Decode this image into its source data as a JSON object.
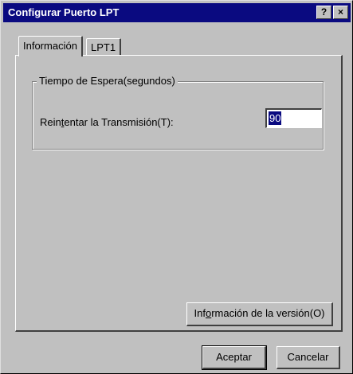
{
  "window": {
    "title": "Configurar Puerto LPT",
    "help_label": "?",
    "close_label": "×"
  },
  "tabs": [
    {
      "label": "Información",
      "active": true
    },
    {
      "label": "LPT1",
      "active": false
    }
  ],
  "group": {
    "legend": "Tiempo de Espera(segundos)",
    "field_label_before": "Rein",
    "field_label_accel": "t",
    "field_label_after": "entar la Transmisión(T):",
    "field_value": "90"
  },
  "buttons": {
    "version_before": "Inf",
    "version_accel": "o",
    "version_after": "rmación de la versión(O)",
    "ok_label": "Aceptar",
    "cancel_label": "Cancelar"
  },
  "colors": {
    "titlebar": "#0a0a80",
    "face": "#c0c0c0"
  }
}
